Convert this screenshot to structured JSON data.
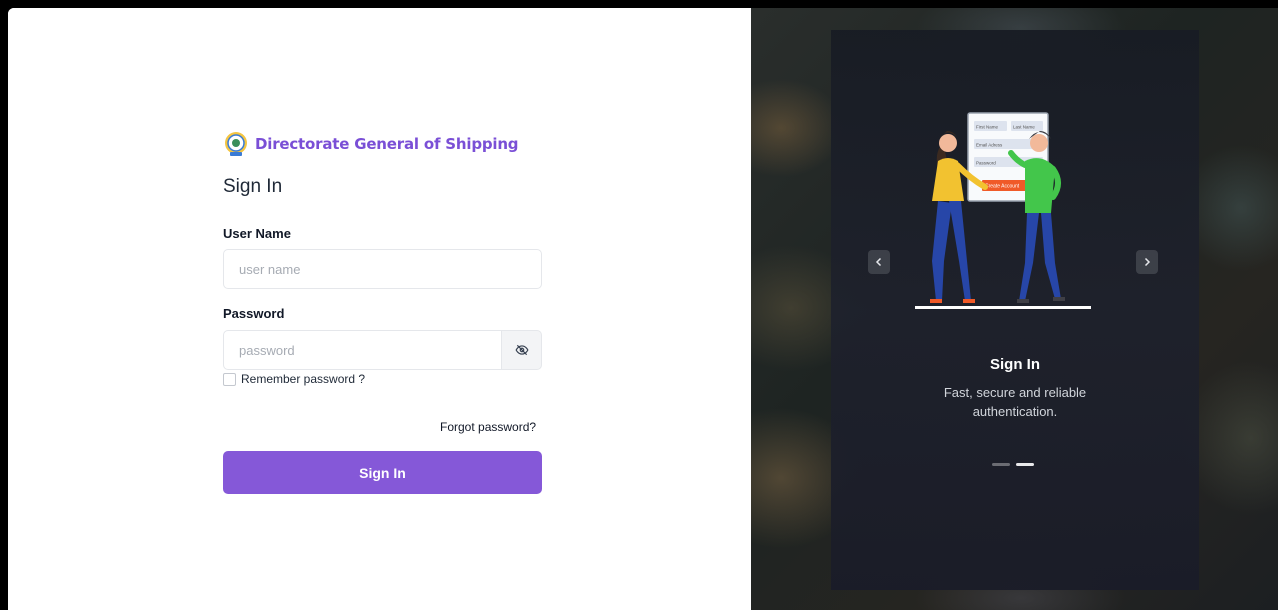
{
  "brand": {
    "name": "Directorate General of Shipping"
  },
  "login": {
    "title": "Sign In",
    "username_label": "User Name",
    "username_placeholder": "user name",
    "password_label": "Password",
    "password_placeholder": "password",
    "remember_label": "Remember password ?",
    "forgot_label": "Forgot password?",
    "submit_label": "Sign In"
  },
  "carousel": {
    "title": "Sign In",
    "description": "Fast, secure and reliable authentication.",
    "illustration_form": {
      "first_name": "First Name",
      "last_name": "Last Name",
      "email": "Email Adress",
      "password": "Password",
      "button": "Create Account"
    },
    "active_slide": 2,
    "slide_count": 2
  },
  "colors": {
    "accent": "#8558d8",
    "brand_text": "#7a4fd6"
  },
  "icons": {
    "logo": "emblem-icon",
    "password_toggle": "eye-off-icon",
    "prev": "chevron-left-icon",
    "next": "chevron-right-icon"
  }
}
